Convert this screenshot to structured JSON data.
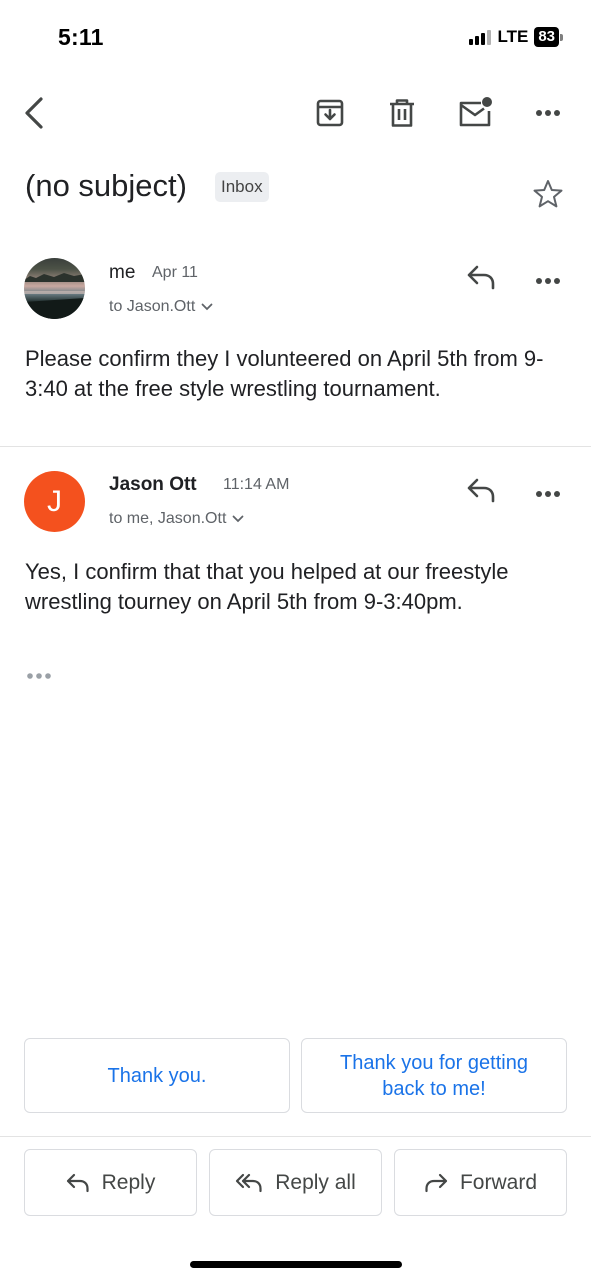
{
  "status_bar": {
    "time": "5:11",
    "network": "LTE",
    "battery": "83"
  },
  "toolbar": {
    "back_icon": "chevron-left-icon",
    "archive_icon": "archive-icon",
    "delete_icon": "trash-icon",
    "unread_icon": "mail-unread-icon",
    "more_icon": "more-horizontal-icon"
  },
  "thread": {
    "subject": "(no subject)",
    "label": "Inbox"
  },
  "messages": [
    {
      "sender": "me",
      "date": "Apr 11",
      "recipients": "to Jason.Ott",
      "body": "Please confirm they I volunteered on April 5th from 9-3:40 at the free style wrestling tournament."
    },
    {
      "sender": "Jason Ott",
      "avatar_letter": "J",
      "date": "11:14 AM",
      "recipients": "to me, Jason.Ott",
      "body": "Yes, I confirm that that you helped at our freestyle wrestling tourney on April 5th from 9-3:40pm."
    }
  ],
  "smart_replies": [
    "Thank you.",
    "Thank you for getting back to me!"
  ],
  "actions": {
    "reply": "Reply",
    "reply_all": "Reply all",
    "forward": "Forward"
  },
  "colors": {
    "accent": "#1a73e8",
    "avatar_orange": "#f4511e",
    "text": "#202124",
    "muted": "#5f6368"
  }
}
